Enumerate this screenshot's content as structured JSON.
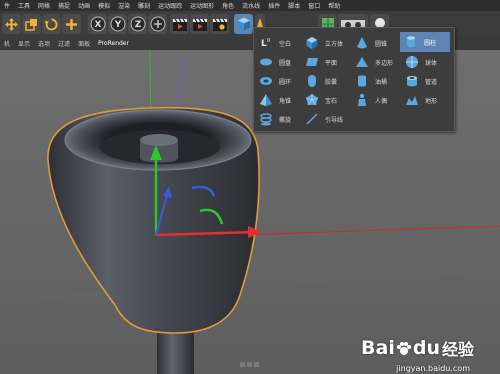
{
  "menubar": {
    "items": [
      "件",
      "工具",
      "网格",
      "捕捉",
      "动画",
      "模拟",
      "渲染",
      "雕刻",
      "运动跟踪",
      "运动图形",
      "角色",
      "流水线",
      "插件",
      "脚本",
      "窗口",
      "帮助"
    ]
  },
  "viewport_menu": {
    "items": [
      "机",
      "显示",
      "选项",
      "过滤",
      "面板"
    ],
    "prorender": "ProRender"
  },
  "popup": {
    "items": [
      {
        "label": "空白",
        "icon": "null-object-icon"
      },
      {
        "label": "立方体",
        "icon": "cube-icon"
      },
      {
        "label": "圆锥",
        "icon": "cone-icon"
      },
      {
        "label": "圆柱",
        "icon": "cylinder-icon",
        "selected": true
      },
      {
        "label": "圆盘",
        "icon": "disc-icon"
      },
      {
        "label": "平面",
        "icon": "plane-icon"
      },
      {
        "label": "多边形",
        "icon": "polygon-icon"
      },
      {
        "label": "球体",
        "icon": "sphere-icon"
      },
      {
        "label": "圆环",
        "icon": "torus-icon"
      },
      {
        "label": "胶囊",
        "icon": "capsule-icon"
      },
      {
        "label": "油桶",
        "icon": "oil-tank-icon"
      },
      {
        "label": "管道",
        "icon": "tube-icon"
      },
      {
        "label": "角锥",
        "icon": "pyramid-icon"
      },
      {
        "label": "宝石",
        "icon": "platonic-icon"
      },
      {
        "label": "人偶",
        "icon": "figure-icon"
      },
      {
        "label": "地形",
        "icon": "landscape-icon"
      },
      {
        "label": "地形",
        "icon": "landscape-icon"
      },
      {
        "label": "螺旋",
        "icon": "helix-icon"
      },
      {
        "label": "引导线",
        "icon": "guide-icon"
      }
    ]
  },
  "watermark": {
    "brand_a": "Bai",
    "brand_b": "du",
    "cn": "经验",
    "url": "jingyan.baidu.com"
  },
  "colors": {
    "accent": "#5d84b3",
    "object_outline": "#e09a3a",
    "axis_x": "#e33030",
    "axis_y": "#2ec52e",
    "axis_z": "#3a5bd6"
  }
}
